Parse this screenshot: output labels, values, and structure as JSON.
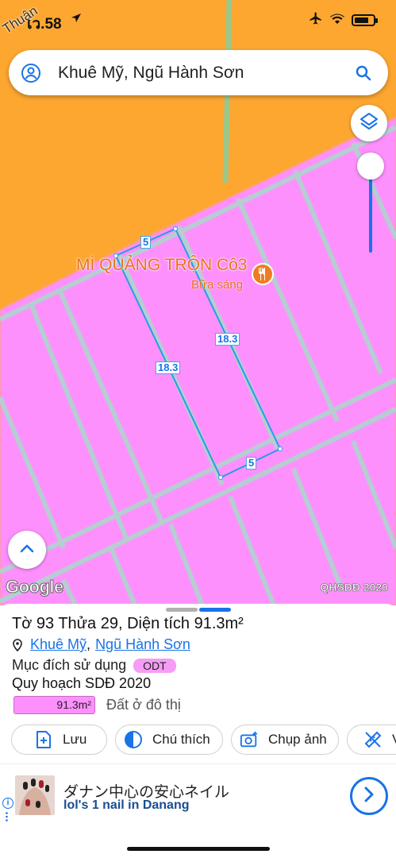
{
  "status_bar": {
    "time": "เว.58",
    "colors": {
      "text": "#111111"
    },
    "icons": [
      "location-arrow-icon",
      "airplane-icon",
      "wifi-icon",
      "battery-icon"
    ]
  },
  "map": {
    "road_name": "Phan Đình Thuận",
    "road_name_visible": "Thuận",
    "colors": {
      "land_orange": "#fda731",
      "land_pink": "#fe90fe",
      "parcel_border": "#b6cdd2",
      "selection": "#2a9be8",
      "road_green": "#9cc78a"
    },
    "poi": {
      "title": "MÌ QUẢNG TRỘN Cô3",
      "subtitle": "Bữa sáng",
      "icon": "restaurant-icon"
    },
    "dimensions": {
      "top": "5",
      "left": "18.3",
      "right": "18.3",
      "bottom": "5"
    },
    "logo": "Google",
    "layer_label": "QHSDĐ 2020"
  },
  "search": {
    "value": "Khuê Mỹ, Ngũ Hành Sơn",
    "icons": [
      "user-icon",
      "search-icon"
    ]
  },
  "controls": {
    "layers_icon": "layers-icon",
    "zoom_level": 0.85,
    "expand_icon": "chevron-up-icon"
  },
  "sheet": {
    "title": "Tờ 93 Thửa 29, Diện tích 91.3m²",
    "address": {
      "ward": "Khuê Mỹ",
      "separator": ",",
      "district": "Ngũ Hành Sơn"
    },
    "purpose_label": "Mục đích sử dụng",
    "purpose_code": "ODT",
    "plan_label": "Quy hoạch SDĐ 2020",
    "area_value": "91.3m²",
    "area_desc": "Đất ở đô thị",
    "actions": [
      {
        "label": "Lưu",
        "icon": "add-document-icon"
      },
      {
        "label": "Chú thích",
        "icon": "contrast-icon"
      },
      {
        "label": "Chụp ảnh",
        "icon": "add-photo-icon"
      },
      {
        "label": "V",
        "icon": "ruler-icon"
      }
    ]
  },
  "ad": {
    "title": "ダナン中心の安心ネイル",
    "subtitle": "lol's 1 nail in Danang",
    "info_icon": "info-icon",
    "cta_icon": "chevron-right-icon"
  }
}
